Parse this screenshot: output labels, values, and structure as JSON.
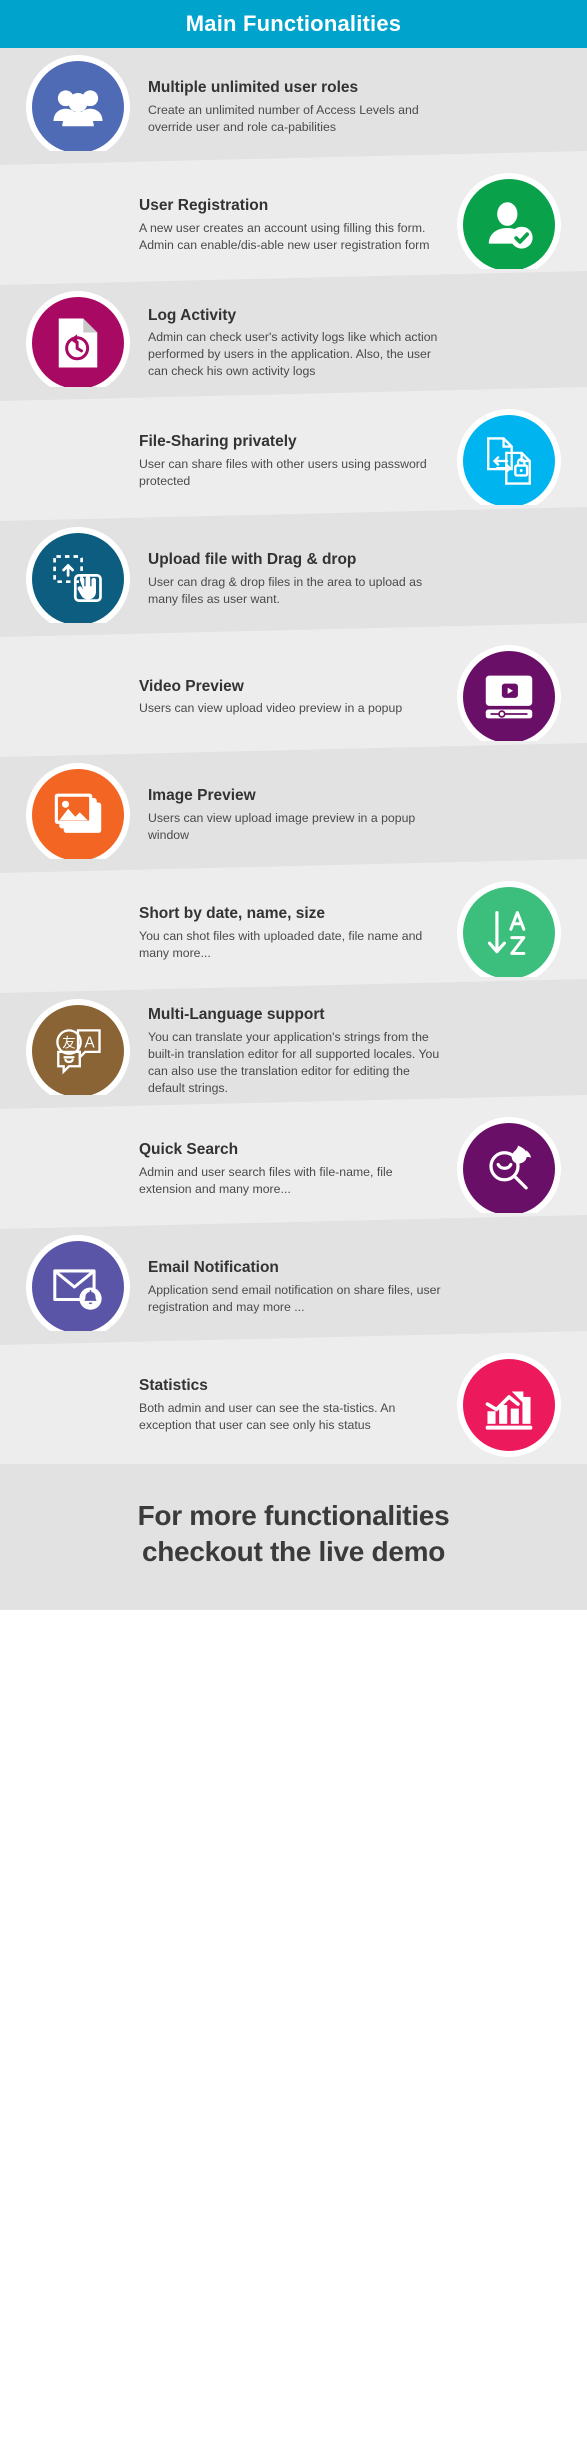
{
  "header": {
    "title": "Main Functionalities",
    "bg_color": "#00a3cc"
  },
  "features": [
    {
      "title": "Multiple unlimited user roles",
      "desc": "Create an unlimited number of Access Levels and override user and role ca-pabilities",
      "icon": "users-group-icon",
      "icon_color": "#4f6bb5",
      "icon_side": "left"
    },
    {
      "title": "User Registration",
      "desc": "A new user creates an account using filling this form. Admin can enable/dis-able new user registration form",
      "icon": "user-check-icon",
      "icon_color": "#0aa14b",
      "icon_side": "right"
    },
    {
      "title": "Log Activity",
      "desc": "Admin can check user's activity logs like which action performed by users in the application. Also, the user can check his own activity logs",
      "icon": "document-history-icon",
      "icon_color": "#a80963",
      "icon_side": "left"
    },
    {
      "title": "File-Sharing privately",
      "desc": "User can share files with other users using password protected",
      "icon": "file-share-lock-icon",
      "icon_color": "#00b4f0",
      "icon_side": "right"
    },
    {
      "title": "Upload file with Drag & drop",
      "desc": "User can drag & drop files in the area to upload as many files as user want.",
      "icon": "drag-drop-upload-icon",
      "icon_color": "#0d5d80",
      "icon_side": "left"
    },
    {
      "title": "Video Preview",
      "desc": "Users can view upload video preview in a popup",
      "icon": "video-player-icon",
      "icon_color": "#6a0f68",
      "icon_side": "right"
    },
    {
      "title": "Image Preview",
      "desc": "Users can view upload image preview in a popup window",
      "icon": "image-stack-icon",
      "icon_color": "#f26522",
      "icon_side": "left"
    },
    {
      "title": "Short by date, name, size",
      "desc": "You can shot files with uploaded date, file name and many more...",
      "icon": "sort-az-icon",
      "icon_color": "#3cbf7d",
      "icon_side": "right"
    },
    {
      "title": "Multi-Language support",
      "desc": "You can translate your application's strings from the built-in translation editor for all supported locales. You can also use the translation editor for editing the default strings.",
      "icon": "translate-icon",
      "icon_color": "#8a6434",
      "icon_side": "left"
    },
    {
      "title": "Quick Search",
      "desc": "Admin and user search files with file-name, file extension and many more...",
      "icon": "search-flame-icon",
      "icon_color": "#6a0f68",
      "icon_side": "right"
    },
    {
      "title": "Email Notification",
      "desc": "Application send email notification on share files, user registration and may more ...",
      "icon": "email-bell-icon",
      "icon_color": "#5b55a8",
      "icon_side": "left"
    },
    {
      "title": "Statistics",
      "desc": "Both admin and user can see the sta-tistics. An exception that user can see only his status",
      "icon": "bar-chart-growth-icon",
      "icon_color": "#ec1a5c",
      "icon_side": "right"
    }
  ],
  "footer": {
    "line1": "For more functionalities",
    "line2": "checkout the live demo"
  }
}
